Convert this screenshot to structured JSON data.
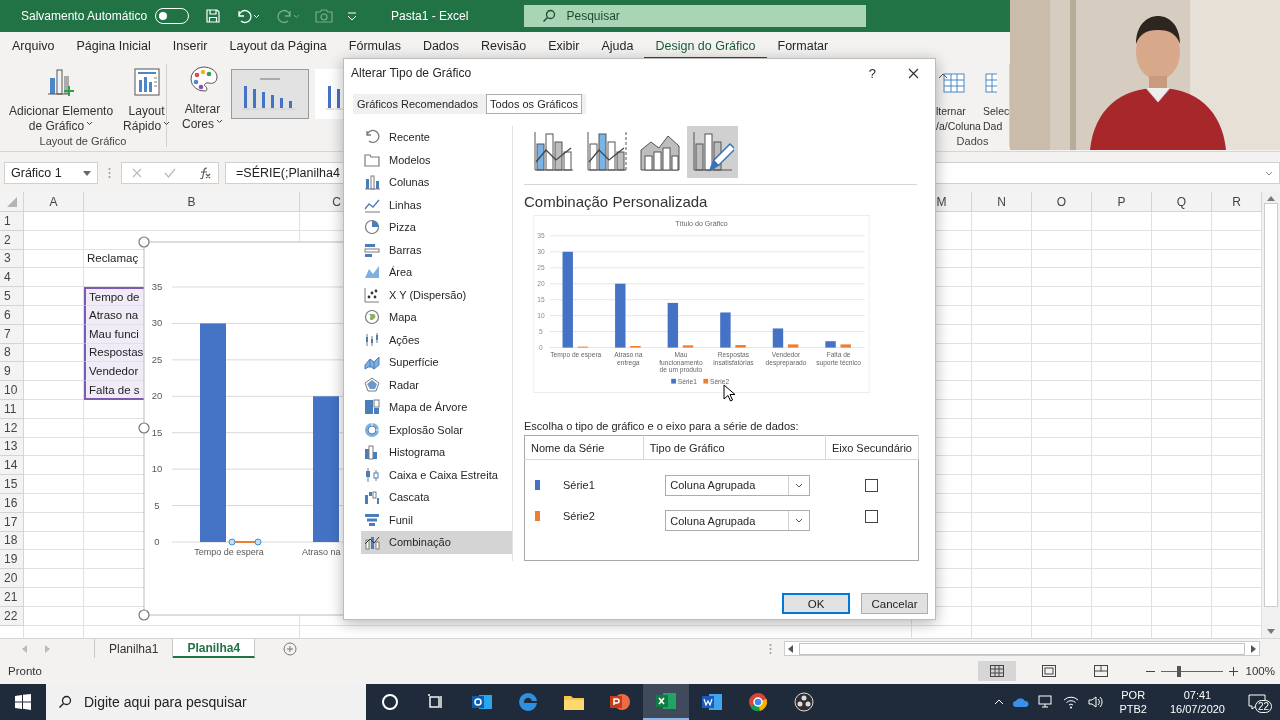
{
  "title_bar": {
    "autosave_label": "Salvamento Automático",
    "autosave_on": false,
    "quick_access": [
      {
        "kind": "save",
        "disabled": false
      },
      {
        "kind": "undo",
        "disabled": false
      },
      {
        "kind": "redo",
        "disabled": true
      },
      {
        "kind": "camera",
        "disabled": true
      },
      {
        "kind": "customize",
        "disabled": false
      }
    ],
    "document_title": "Pasta1 - Excel",
    "search": {
      "placeholder": "Pesquisar"
    }
  },
  "ribbon_tabs": [
    {
      "label": "Arquivo",
      "selected": false
    },
    {
      "label": "Página Inicial",
      "selected": false
    },
    {
      "label": "Inserir",
      "selected": false
    },
    {
      "label": "Layout da Página",
      "selected": false
    },
    {
      "label": "Fórmulas",
      "selected": false
    },
    {
      "label": "Dados",
      "selected": false
    },
    {
      "label": "Revisão",
      "selected": false
    },
    {
      "label": "Exibir",
      "selected": false
    },
    {
      "label": "Ajuda",
      "selected": false
    },
    {
      "label": "Design do Gráfico",
      "selected": true
    },
    {
      "label": "Formatar",
      "selected": false
    }
  ],
  "ribbon": {
    "groups": [
      {
        "label": "Layout de Gráfico",
        "buttons": [
          {
            "kind": "add-element",
            "lines": [
              "Adicionar Elemento",
              "de Gráfico"
            ],
            "dropdown": true
          },
          {
            "kind": "quick-layout",
            "lines": [
              "Layout",
              "Rápido"
            ],
            "dropdown": true
          }
        ]
      },
      {
        "buttons": [
          {
            "kind": "colors",
            "lines": [
              "Alterar",
              "Cores"
            ],
            "dropdown": true
          }
        ],
        "styles": [
          {
            "selected": true
          },
          {
            "selected": false
          }
        ]
      }
    ],
    "right_group": {
      "label": "Dados",
      "buttons": [
        {
          "kind": "switch",
          "lines": [
            "lternar",
            "/a/Coluna"
          ],
          "dropdown": false
        },
        {
          "kind": "select-data",
          "lines": [
            "Selec",
            "Dad"
          ],
          "dropdown": false
        }
      ]
    }
  },
  "formula_bar": {
    "name_box": "Gráfico 1",
    "formula": "=SÉRIE(;Planilha4"
  },
  "sheet": {
    "columns": [
      "A",
      "B",
      "C",
      "M",
      "N",
      "O",
      "P",
      "Q",
      "R"
    ],
    "rows": [
      {
        "number": "1",
        "in_selection": false
      },
      {
        "number": "2",
        "in_selection": false
      },
      {
        "number": "3",
        "col_b": "Reclamaç",
        "in_selection": false
      },
      {
        "number": "4",
        "in_selection": false
      },
      {
        "number": "5",
        "col_b": "Tempo de",
        "in_selection": true
      },
      {
        "number": "6",
        "col_b": "Atraso na",
        "in_selection": true
      },
      {
        "number": "7",
        "col_b": "Mau funci",
        "in_selection": true
      },
      {
        "number": "8",
        "col_b": "Respostas",
        "in_selection": true
      },
      {
        "number": "9",
        "col_b": "Vendedor",
        "in_selection": true
      },
      {
        "number": "10",
        "col_b": "Falta de s",
        "in_selection": true
      },
      {
        "number": "11",
        "in_selection": false
      },
      {
        "number": "12",
        "in_selection": false
      },
      {
        "number": "13",
        "in_selection": false
      },
      {
        "number": "14",
        "in_selection": false
      },
      {
        "number": "15",
        "in_selection": false
      },
      {
        "number": "16",
        "in_selection": false
      },
      {
        "number": "17",
        "in_selection": false
      },
      {
        "number": "18",
        "in_selection": false
      },
      {
        "number": "19",
        "in_selection": false
      },
      {
        "number": "20",
        "in_selection": false
      },
      {
        "number": "21",
        "in_selection": false
      },
      {
        "number": "22",
        "in_selection": false
      }
    ],
    "chart": {
      "chart_data": {
        "type": "bar",
        "categories": [
          "Tempo de espera",
          "Atraso na"
        ],
        "series": [
          {
            "color": "#4472c4",
            "values": [
              30,
              20
            ]
          }
        ],
        "yticks": [
          0,
          5,
          10,
          15,
          20,
          25,
          30,
          35
        ],
        "ylim": [
          0,
          35
        ],
        "grid": true
      }
    }
  },
  "sheet_tabs": [
    {
      "label": "Planilha1",
      "selected": false
    },
    {
      "label": "Planilha4",
      "selected": true
    }
  ],
  "status_bar": {
    "status": "Pronto",
    "views": [
      {
        "kind": "normal",
        "selected": true
      },
      {
        "kind": "page-layout",
        "selected": false
      },
      {
        "kind": "page-break",
        "selected": false
      }
    ],
    "zoom": {
      "level": 0.3,
      "reading": "100%"
    }
  },
  "taskbar": {
    "search": {
      "placeholder": "Digite aqui para pesquisar"
    },
    "apps": [
      {
        "kind": "cortana",
        "active": false
      },
      {
        "kind": "task-view",
        "active": false
      },
      {
        "kind": "mail",
        "active": false
      },
      {
        "kind": "edge",
        "active": false
      },
      {
        "kind": "explorer",
        "active": false
      },
      {
        "kind": "powerpoint",
        "active": false
      },
      {
        "kind": "excel",
        "active": true
      },
      {
        "kind": "word",
        "active": false
      },
      {
        "kind": "chrome",
        "active": false
      },
      {
        "kind": "obs",
        "active": false
      }
    ],
    "language": "POR",
    "keyboard": "PTB2",
    "time": "07:41",
    "date": "16/07/2020",
    "notifications": "22"
  },
  "dialog": {
    "title": "Alterar Tipo de Gráfico",
    "help": "?",
    "tabs": [
      {
        "label": "Gráficos Recomendados",
        "selected": false
      },
      {
        "label": "Todos os Gráficos",
        "selected": true
      }
    ],
    "chart_types": [
      {
        "kind": "recent",
        "label": "Recente",
        "selected": false
      },
      {
        "kind": "templates",
        "label": "Modelos",
        "selected": false
      },
      {
        "kind": "column",
        "label": "Colunas",
        "selected": false
      },
      {
        "kind": "line",
        "label": "Linhas",
        "selected": false
      },
      {
        "kind": "pie",
        "label": "Pizza",
        "selected": false
      },
      {
        "kind": "bar",
        "label": "Barras",
        "selected": false
      },
      {
        "kind": "area",
        "label": "Área",
        "selected": false
      },
      {
        "kind": "scatter",
        "label": "X Y (Dispersão)",
        "selected": false
      },
      {
        "kind": "map",
        "label": "Mapa",
        "selected": false
      },
      {
        "kind": "stock",
        "label": "Ações",
        "selected": false
      },
      {
        "kind": "surface",
        "label": "Superfície",
        "selected": false
      },
      {
        "kind": "radar",
        "label": "Radar",
        "selected": false
      },
      {
        "kind": "treemap",
        "label": "Mapa de Árvore",
        "selected": false
      },
      {
        "kind": "sunburst",
        "label": "Explosão Solar",
        "selected": false
      },
      {
        "kind": "histogram",
        "label": "Histograma",
        "selected": false
      },
      {
        "kind": "boxwhisker",
        "label": "Caixa e Caixa Estreita",
        "selected": false
      },
      {
        "kind": "waterfall",
        "label": "Cascata",
        "selected": false
      },
      {
        "kind": "funnel",
        "label": "Funil",
        "selected": false
      },
      {
        "kind": "combo",
        "label": "Combinação",
        "selected": true
      }
    ],
    "subtypes": [
      {
        "kind": "column-line",
        "selected": false
      },
      {
        "kind": "column-line-secondary",
        "selected": false
      },
      {
        "kind": "area-column",
        "selected": false
      },
      {
        "kind": "custom",
        "selected": true
      }
    ],
    "heading": "Combinação Personalizada",
    "preview": {
      "chart_data": {
        "type": "bar",
        "title": "Título do Gráfico",
        "categories": [
          "Tempo de espera",
          "Atraso na entrega",
          "Mau funcionamento de um produto",
          "Respostas insatisfatórias",
          "Vendedor despreparado",
          "Falta de suporte técnico"
        ],
        "series": [
          {
            "name": "Série1",
            "color": "#4472c4",
            "values": [
              30,
              20,
              14,
              11,
              6,
              2
            ]
          },
          {
            "name": "Série2",
            "color": "#ed7d31",
            "values": [
              0.3,
              0.5,
              0.7,
              0.8,
              1,
              1
            ]
          }
        ],
        "yticks": [
          0,
          5,
          10,
          15,
          20,
          25,
          30,
          35
        ],
        "ylim": [
          0,
          35
        ],
        "grid": true,
        "legend": true
      }
    },
    "series_prompt": "Escolha o tipo de gráfico e o eixo para a série de dados:",
    "series_table": {
      "columns": [
        "Nome da Série",
        "Tipo de Gráfico",
        "Eixo Secundário"
      ],
      "rows": [
        {
          "name": "Série1",
          "color": "#4472c4",
          "chart_type": "Coluna Agrupada",
          "secondary_axis": false
        },
        {
          "name": "Série2",
          "color": "#ed7d31",
          "chart_type": "Coluna Agrupada",
          "secondary_axis": false
        }
      ]
    },
    "buttons": [
      {
        "label": "OK",
        "kind": "primary"
      },
      {
        "label": "Cancelar",
        "kind": "secondary"
      }
    ]
  }
}
